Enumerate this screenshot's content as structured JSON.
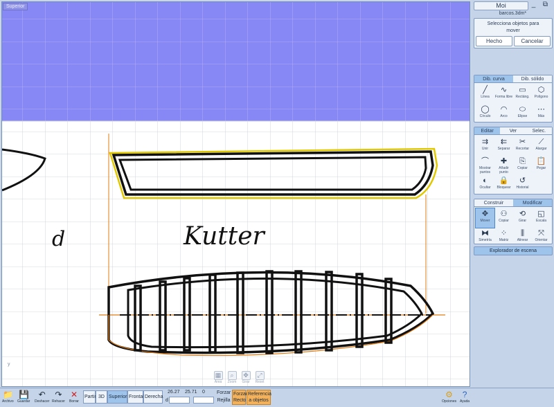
{
  "viewport": {
    "title": "Superior",
    "annotation_d": "d",
    "annotation_kutter": "Kutter",
    "axis_label": "y",
    "nav_tools": [
      {
        "icon": "pan-icon",
        "label": "Área"
      },
      {
        "icon": "zoom-icon",
        "label": "Zoom"
      },
      {
        "icon": "orbit-icon",
        "label": "Girar"
      },
      {
        "icon": "reset-icon",
        "label": "Reset"
      }
    ]
  },
  "window": {
    "title": "Moi",
    "minimize": "_",
    "restore": "⧉",
    "close": "✕"
  },
  "file": {
    "name": "barcos.3dm*"
  },
  "prompt": {
    "line1": "Selecciona objetos para",
    "line2": "mover",
    "done_label": "Hecho",
    "cancel_label": "Cancelar"
  },
  "draw_palette": {
    "tabs": [
      "Dib. curva",
      "Dib. sólido"
    ],
    "active_tab": 0,
    "tools": [
      {
        "icon": "line-icon",
        "glyph": "╱",
        "label": "Línea"
      },
      {
        "icon": "freeform-icon",
        "glyph": "∿",
        "label": "Forma libre"
      },
      {
        "icon": "rectangle-icon",
        "glyph": "▭",
        "label": "Rectáng."
      },
      {
        "icon": "polygon-icon",
        "glyph": "⬡",
        "label": "Polígono"
      },
      {
        "icon": "circle-icon",
        "glyph": "◯",
        "label": "Círculo"
      },
      {
        "icon": "arc-icon",
        "glyph": "◠",
        "label": "Arco"
      },
      {
        "icon": "ellipse-icon",
        "glyph": "⬭",
        "label": "Elipse"
      },
      {
        "icon": "more-icon",
        "glyph": "⋯",
        "label": "Más"
      }
    ]
  },
  "edit_palette": {
    "tabs": [
      "Editar",
      "Ver",
      "Selec."
    ],
    "active_tab": 0,
    "tools": [
      {
        "icon": "join-icon",
        "glyph": "⇉",
        "label": "Unir"
      },
      {
        "icon": "separate-icon",
        "glyph": "⇇",
        "label": "Separar"
      },
      {
        "icon": "trim-icon",
        "glyph": "✂",
        "label": "Recortar"
      },
      {
        "icon": "extend-icon",
        "glyph": "⟋",
        "label": "Alargar"
      },
      {
        "icon": "show-points-icon",
        "glyph": "⌒",
        "label": "Mostrar puntos"
      },
      {
        "icon": "add-point-icon",
        "glyph": "✚",
        "label": "Añadir punto"
      },
      {
        "icon": "copy-icon",
        "glyph": "⎘",
        "label": "Copiar"
      },
      {
        "icon": "paste-icon",
        "glyph": "📋",
        "label": "Pegar"
      },
      {
        "icon": "hide-icon",
        "glyph": "◐",
        "label": "Ocultar"
      },
      {
        "icon": "lock-icon",
        "glyph": "🔒",
        "label": "Bloquear"
      },
      {
        "icon": "history-icon",
        "glyph": "↺",
        "label": "Historial"
      }
    ]
  },
  "transform_palette": {
    "tabs": [
      "Construir",
      "Modificar"
    ],
    "active_tab": 1,
    "tools": [
      {
        "icon": "move-icon",
        "glyph": "✥",
        "label": "Mover",
        "selected": true
      },
      {
        "icon": "copy-transform-icon",
        "glyph": "⚇",
        "label": "Copiar"
      },
      {
        "icon": "rotate-icon",
        "glyph": "⟲",
        "label": "Girar"
      },
      {
        "icon": "scale-icon",
        "glyph": "◱",
        "label": "Escala"
      },
      {
        "icon": "mirror-icon",
        "glyph": "⧓",
        "label": "Simetría"
      },
      {
        "icon": "array-icon",
        "glyph": "⁘",
        "label": "Matriz"
      },
      {
        "icon": "align-icon",
        "glyph": "⫼",
        "label": "Alinear"
      },
      {
        "icon": "orient-icon",
        "glyph": "⤧",
        "label": "Orientar"
      }
    ]
  },
  "scene_browser": {
    "label": "Explorador de escena"
  },
  "bottom": {
    "file_items": [
      {
        "icon": "folder-icon",
        "glyph": "📁",
        "label": "Archivo"
      },
      {
        "icon": "save-icon",
        "glyph": "💾",
        "label": "Guardar"
      },
      {
        "icon": "undo-icon",
        "glyph": "↶",
        "label": "Deshacer"
      },
      {
        "icon": "redo-icon",
        "glyph": "↷",
        "label": "Rehacer"
      },
      {
        "icon": "delete-icon",
        "glyph": "✕",
        "label": "Borrar"
      }
    ],
    "views": [
      "Partir",
      "3D",
      "Superior",
      "Frontal",
      "Derecha"
    ],
    "active_view": "Superior",
    "coords": {
      "x": "26.27",
      "y": "25.71",
      "z": "0",
      "d_label": "d"
    },
    "snaps": {
      "forzar": "Forzar",
      "rejilla": "Rejilla",
      "forzar_recto": [
        "Forzar",
        "Recto"
      ],
      "referencia": [
        "Referencia",
        "a objetos"
      ]
    },
    "options_label": "Opciones",
    "help_label": "Ayuda"
  },
  "colors": {
    "sky": "#8787f5",
    "selection": "#e0c800",
    "guide": "#e07a10",
    "grid": "#c8ccd4",
    "panel": "#c5d4e8",
    "tab_active": "#9fc4ec",
    "snap_active": "#f2b15a"
  }
}
